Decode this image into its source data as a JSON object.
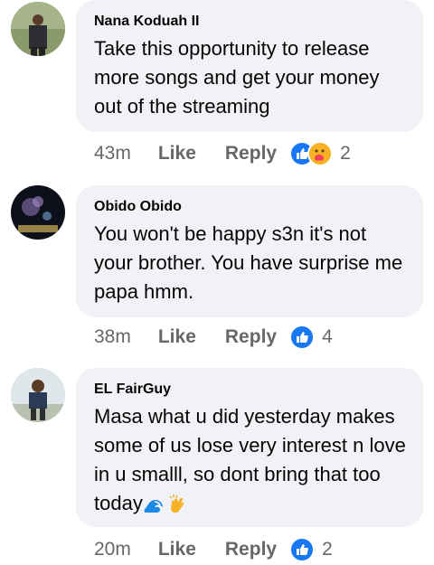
{
  "comments": [
    {
      "author": "Nana Koduah II",
      "text": "Take this opportunity to release more songs and get your money out of the streaming",
      "time": "43m",
      "like_label": "Like",
      "reply_label": "Reply",
      "reaction_icons": [
        "like-icon",
        "care-icon"
      ],
      "reaction_count": "2"
    },
    {
      "author": "Obido Obido",
      "text": "You won't be happy s3n it's not your brother. You have surprise me papa hmm.",
      "time": "38m",
      "like_label": "Like",
      "reply_label": "Reply",
      "reaction_icons": [
        "like-icon"
      ],
      "reaction_count": "4"
    },
    {
      "author": "EL FairGuy",
      "text": "Masa what u did yesterday makes some of us lose very interest n love in u smalll, so dont bring that too today",
      "emojis": [
        "water-wave-emoji",
        "clapping-hands-emoji"
      ],
      "time": "20m",
      "like_label": "Like",
      "reply_label": "Reply",
      "reaction_icons": [
        "like-icon"
      ],
      "reaction_count": "2"
    }
  ],
  "colors": {
    "bubble_bg": "#f0f2f5",
    "meta_text": "#65676b",
    "like_blue": "#1877f2",
    "care_yellow": "#f7b125"
  }
}
